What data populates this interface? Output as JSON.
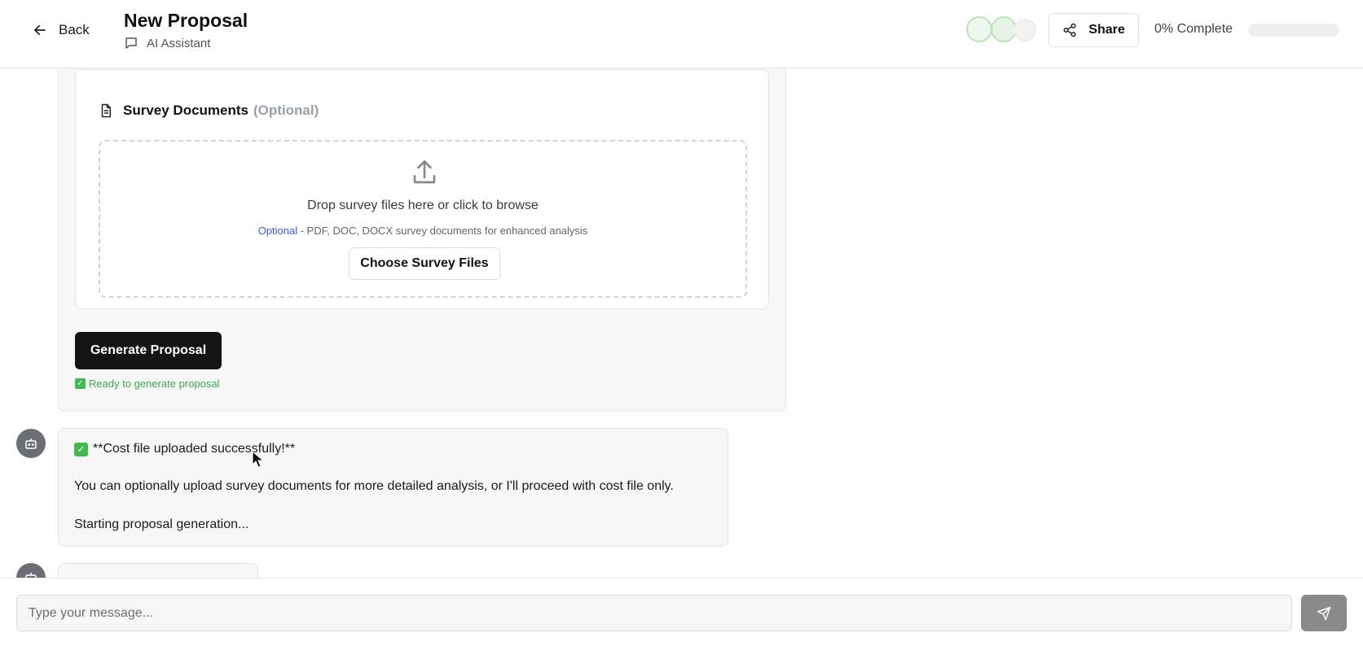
{
  "header": {
    "back_label": "Back",
    "title": "New Proposal",
    "subtitle": "AI Assistant",
    "share_label": "Share",
    "progress_label": "0% Complete",
    "progress_value": 0
  },
  "survey": {
    "heading": "Survey Documents",
    "optional_tag": "(Optional)",
    "drop_text": "Drop survey files here or click to browse",
    "hint_accent": "Optional",
    "hint_rest": " - PDF, DOC, DOCX survey documents for enhanced analysis",
    "choose_label": "Choose Survey Files"
  },
  "generate": {
    "button_label": "Generate Proposal",
    "status_text": "Ready to generate proposal"
  },
  "messages": [
    {
      "line1": "**Cost file uploaded successfully!**",
      "line2": "You can optionally upload survey documents for more detailed analysis, or I'll proceed with cost file only.",
      "line3": "Starting proposal generation..."
    }
  ],
  "composer": {
    "placeholder": "Type your message..."
  },
  "colors": {
    "accent": "#3b5bdb",
    "success": "#3fb950",
    "primary_button": "#141414",
    "send_button": "#8a8a8a"
  },
  "icons": {
    "back": "arrow-left-icon",
    "chat": "message-square-icon",
    "share": "share-icon",
    "document": "file-text-icon",
    "upload": "upload-icon",
    "check": "check-box-icon",
    "bot": "bot-icon",
    "send": "send-icon"
  }
}
